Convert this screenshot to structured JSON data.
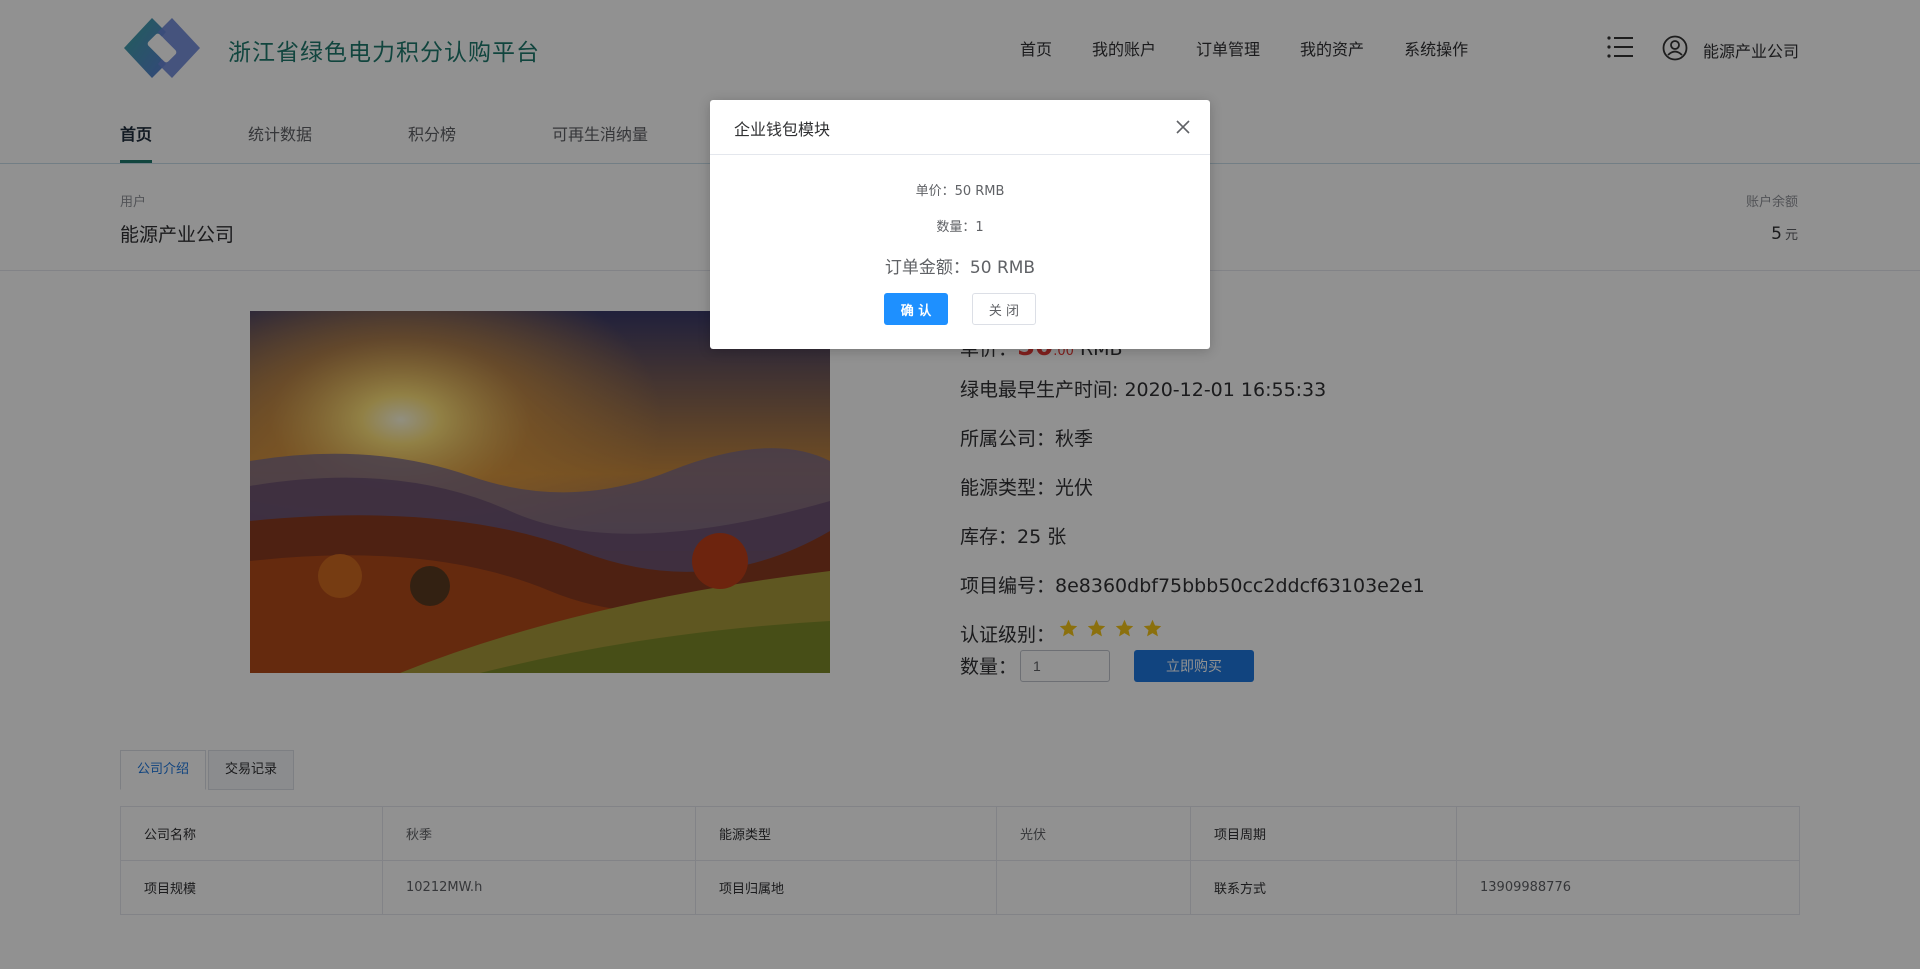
{
  "header": {
    "site_title": "浙江省绿色电力积分认购平台",
    "nav": [
      "首页",
      "我的账户",
      "订单管理",
      "我的资产",
      "系统操作"
    ],
    "menu_icon": "menu-list-icon",
    "user_icon": "user-circle-icon",
    "user_name": "能源产业公司"
  },
  "sub_nav": {
    "tabs": [
      "首页",
      "统计数据",
      "积分榜",
      "可再生消纳量"
    ],
    "active": "首页"
  },
  "account": {
    "user_label": "用户",
    "company": "能源产业公司",
    "balance_label": "账户余额",
    "balance_value": "5",
    "balance_unit": "元"
  },
  "product": {
    "image": "autumn-mountain-sunrise-landscape",
    "price_label": "单价：",
    "price_int": "50",
    "price_dec": ".00",
    "price_unit": "RMB",
    "earliest_time": "绿电最早生产时间: 2020-12-01 16:55:33",
    "company": "所属公司：秋季",
    "energy_type": "能源类型：光伏",
    "stock": "库存：25 张",
    "project_no": "项目编号：8e8360dbf75bbb50cc2ddcf63103e2e1",
    "cert_level_label": "认证级别：",
    "cert_stars": 4,
    "qty_label": "数量：",
    "qty_value": "1",
    "buy_label": "立即购买"
  },
  "bottom_tabs": [
    "公司介绍",
    "交易记录"
  ],
  "info_table": [
    [
      "公司名称",
      "秋季",
      "能源类型",
      "光伏",
      "项目周期",
      ""
    ],
    [
      "项目规模",
      "10212MW.h",
      "项目归属地",
      "",
      "联系方式",
      "13909988776"
    ]
  ],
  "dialog": {
    "title": "企业钱包模块",
    "unit_price": "单价：50 RMB",
    "quantity": "数量：1",
    "order_amount": "订单金额：50 RMB",
    "confirm": "确 认",
    "close": "关 闭"
  },
  "colors": {
    "brand": "#1f7a6e",
    "primary_button": "#1e90ff",
    "buy_button": "#1e78e0",
    "price": "#e53935",
    "star": "#f5c518",
    "overlay": "rgba(0,0,0,0.43)"
  }
}
